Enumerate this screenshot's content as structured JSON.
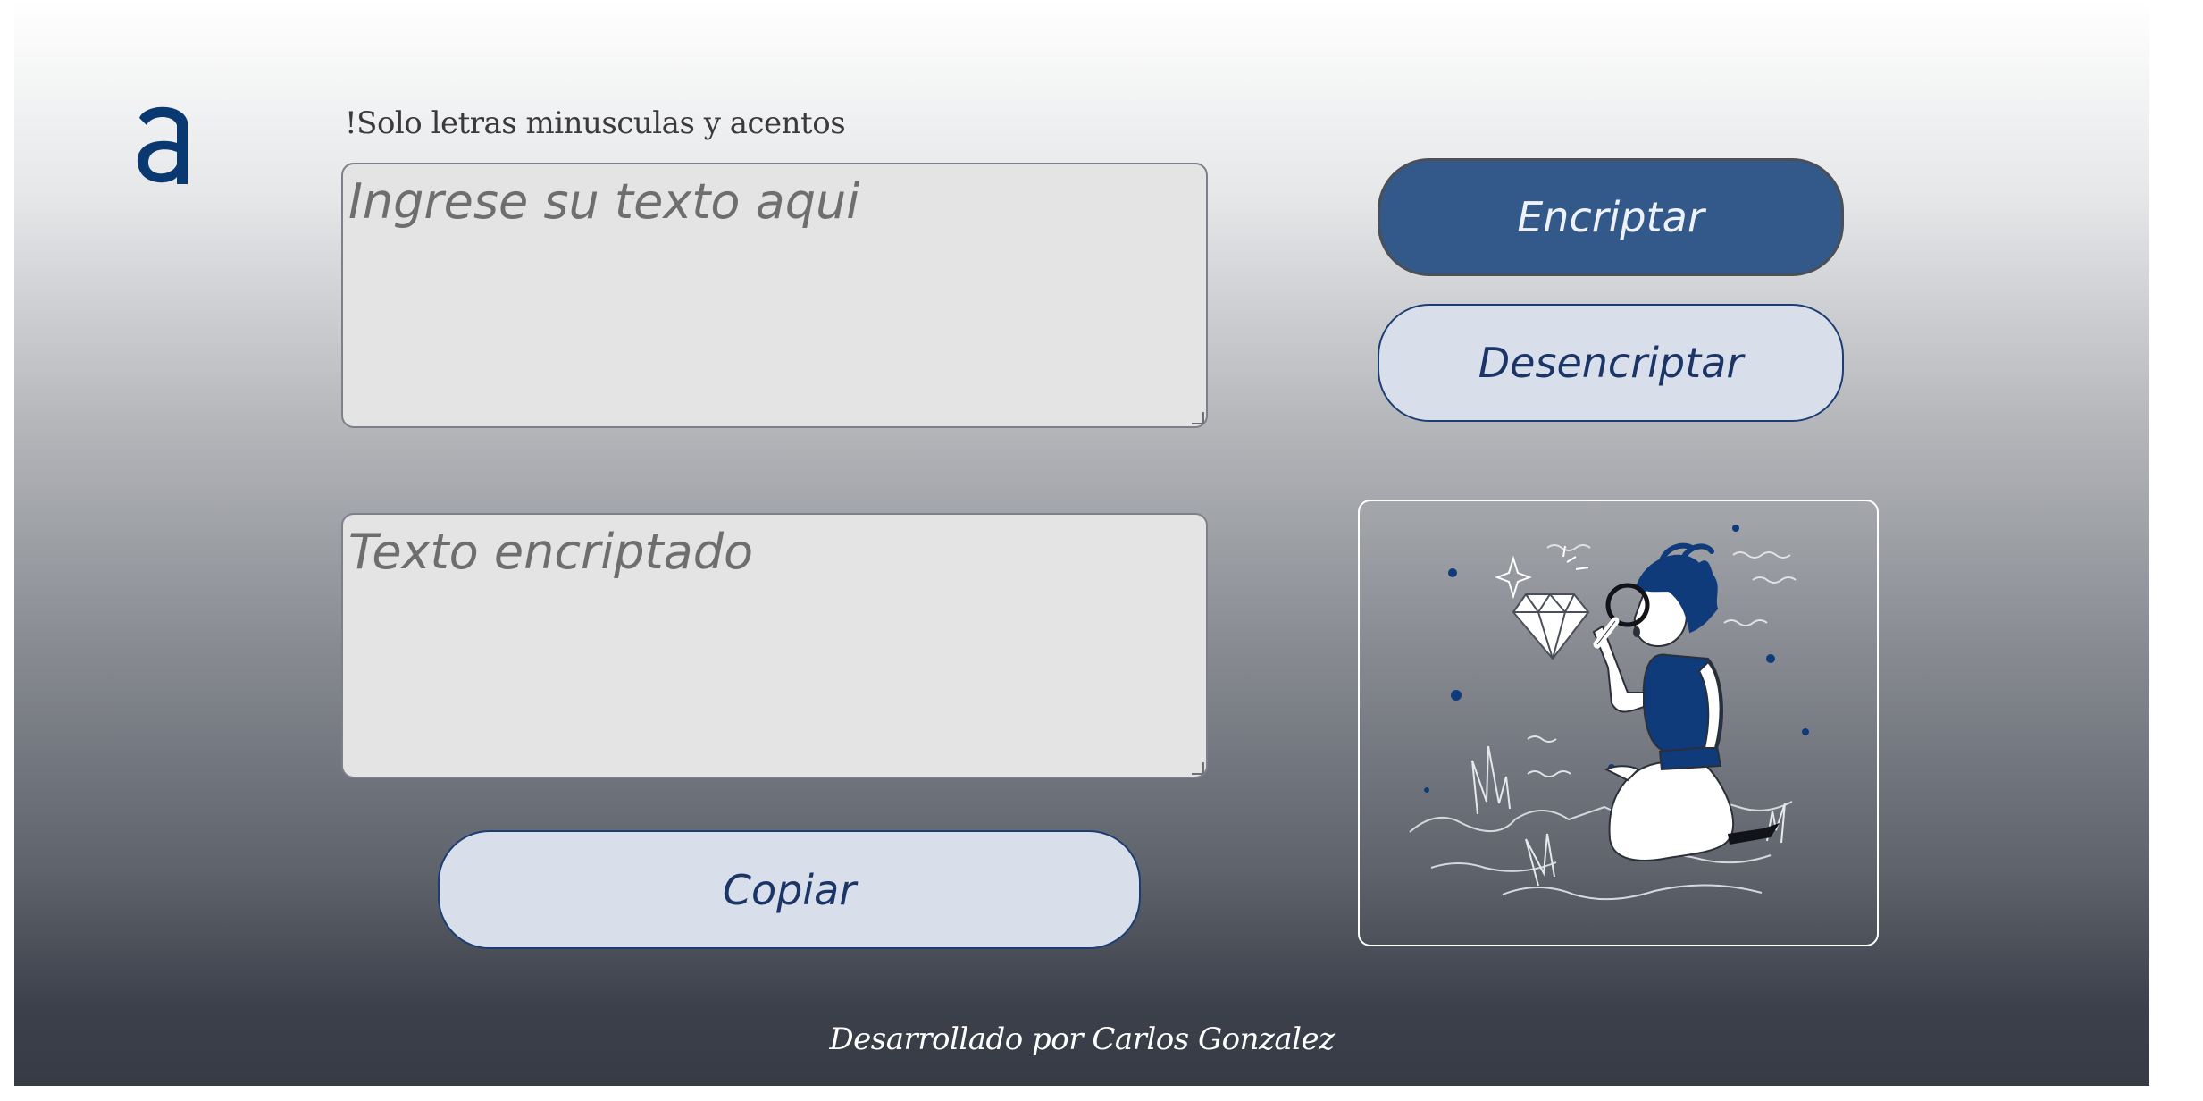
{
  "logo": {
    "icon": "alura-a-logo-icon",
    "color": "#0a3871"
  },
  "hint": {
    "text": "!Solo letras minusculas y acentos"
  },
  "input": {
    "placeholder": "Ingrese su texto aqui",
    "value": ""
  },
  "output": {
    "placeholder": "Texto encriptado",
    "value": ""
  },
  "buttons": {
    "encrypt_label": "Encriptar",
    "decrypt_label": "Desencriptar",
    "copy_label": "Copiar"
  },
  "illustration": {
    "icon": "person-with-magnifier-and-diamond-illustration"
  },
  "footer": {
    "text": "Desarrollado por Carlos Gonzalez"
  },
  "colors": {
    "accent": "#33598a",
    "secondary_button_bg": "#d8dfea",
    "secondary_button_text": "#1a3566",
    "textbox_bg": "#e4e4e4"
  }
}
